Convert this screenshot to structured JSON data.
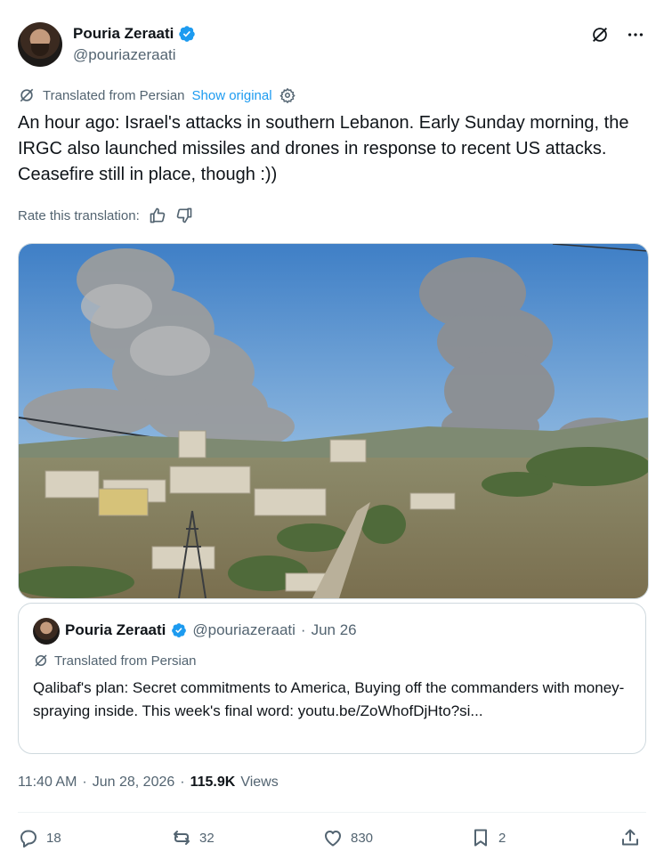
{
  "author": {
    "name": "Pouria Zeraati",
    "handle": "@pouriazeraati"
  },
  "translation": {
    "notice": "Translated from Persian",
    "show_original": "Show original",
    "rate_label": "Rate this translation:"
  },
  "tweet": {
    "text": "An hour ago: Israel's attacks in southern Lebanon. Early Sunday morning, the IRGC also launched missiles and drones in response to recent US attacks. Ceasefire still in place, though :))"
  },
  "quote": {
    "name": "Pouria Zeraati",
    "handle": "@pouriazeraati",
    "dot": "·",
    "date": "Jun 26",
    "notice": "Translated from Persian",
    "text": "Qalibaf's plan: Secret commitments to America, Buying off the commanders with money-spraying inside. This week's final word: youtu.be/ZoWhofDjHto?si..."
  },
  "meta": {
    "time": "11:40 AM",
    "sep1": "·",
    "date": "Jun 28, 2026",
    "sep2": "·",
    "views_count": "115.9K",
    "views_label": "Views"
  },
  "actions": {
    "replies": "18",
    "reposts": "32",
    "likes": "830",
    "bookmarks": "2"
  },
  "colors": {
    "accent": "#1d9bf0",
    "text": "#0f1419",
    "muted": "#536471",
    "border": "#cfd9de"
  },
  "icons": [
    "verified-badge-icon",
    "grok-icon",
    "more-icon",
    "translate-icon",
    "gear-icon",
    "thumbs-up-icon",
    "thumbs-down-icon",
    "reply-icon",
    "repost-icon",
    "like-icon",
    "bookmark-icon",
    "share-icon"
  ]
}
